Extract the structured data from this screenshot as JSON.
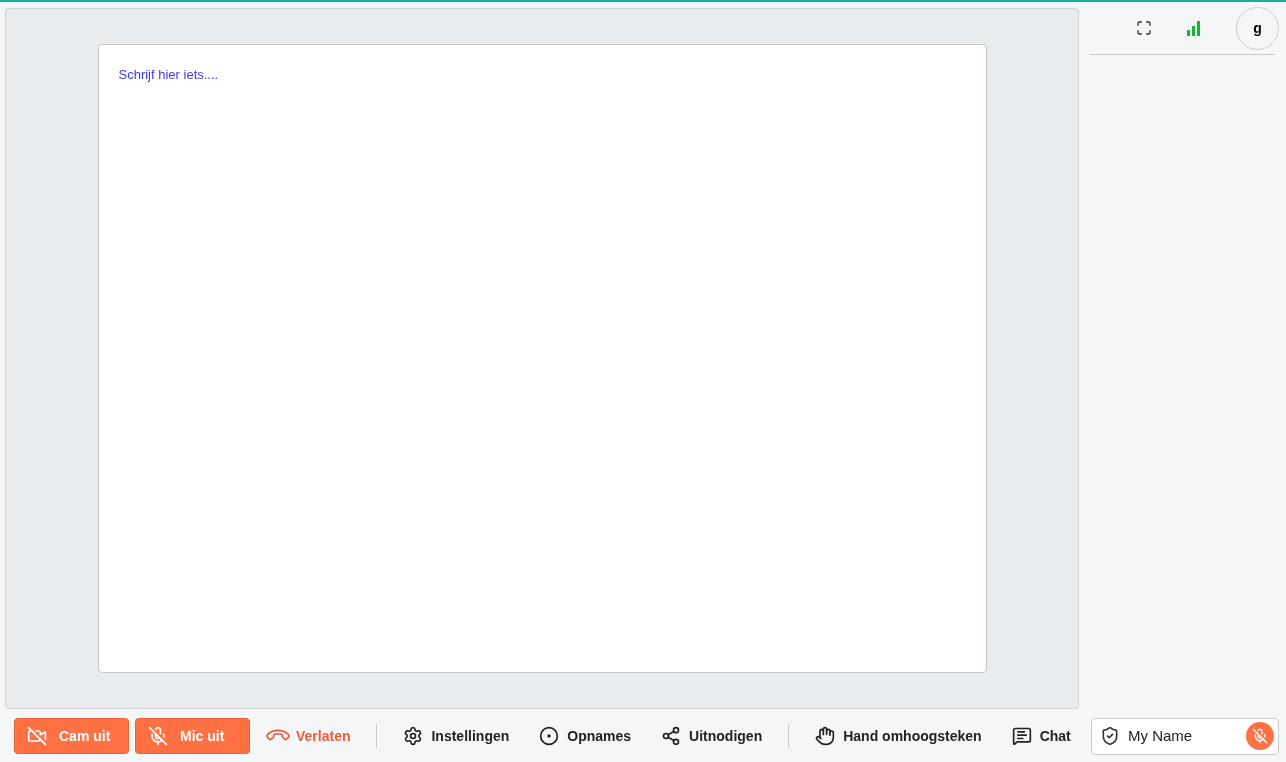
{
  "editor": {
    "placeholder": "Schrijf hier iets...."
  },
  "header": {
    "avatar": "g"
  },
  "toolbar": [
    {
      "kind": "toggle",
      "label": "Cam uit",
      "on": false,
      "divider_after": false
    },
    {
      "kind": "toggle",
      "label": "Mic uit",
      "on": false,
      "divider_after": false
    },
    {
      "kind": "leave",
      "label": "Verlaten",
      "divider_after": true
    },
    {
      "kind": "action",
      "label": "Instellingen",
      "divider_after": false
    },
    {
      "kind": "action",
      "label": "Opnames",
      "divider_after": false
    },
    {
      "kind": "action",
      "label": "Uitnodigen",
      "divider_after": true
    },
    {
      "kind": "action",
      "label": "Hand omhoogsteken",
      "divider_after": false
    },
    {
      "kind": "action",
      "label": "Chat",
      "divider_after": false
    }
  ],
  "participant": {
    "name": "My Name",
    "mic_on": false
  }
}
